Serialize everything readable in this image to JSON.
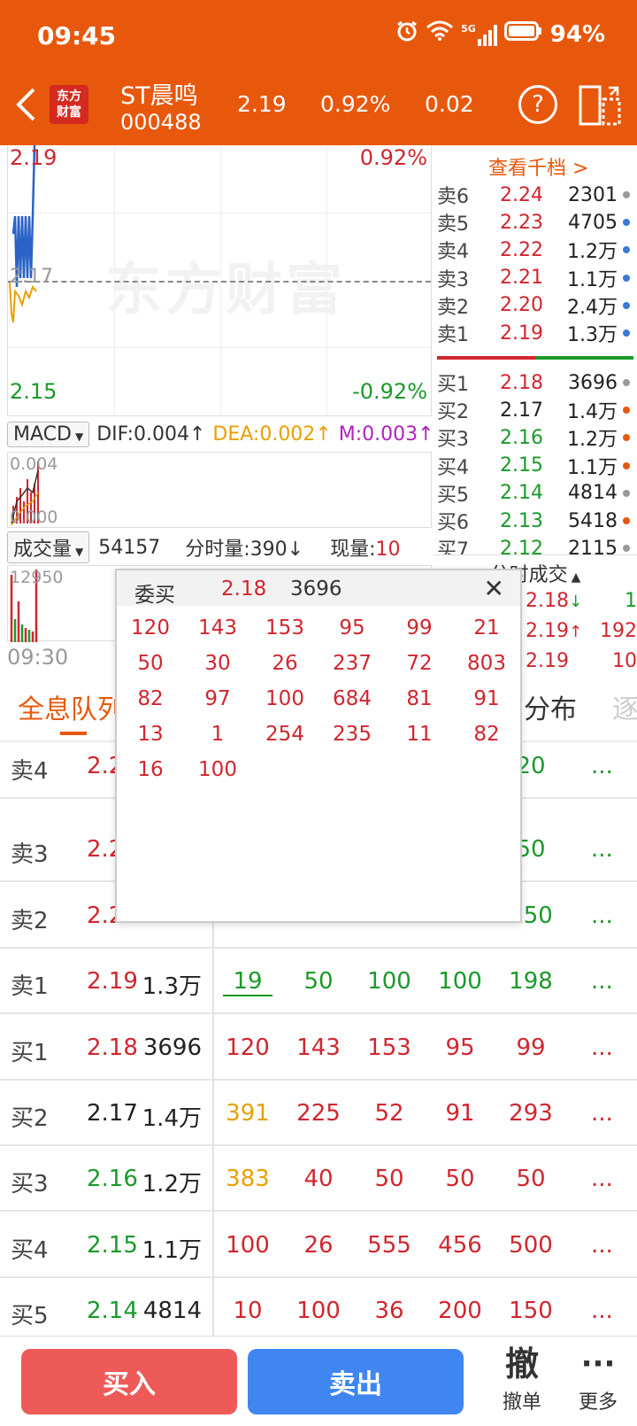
{
  "status_bar": {
    "time": "09:45",
    "battery": "94%",
    "network": "5G"
  },
  "header": {
    "logo_line1": "东方",
    "logo_line2": "财富",
    "stock_name": "ST晨鸣",
    "stock_code": "000488",
    "price": "2.19",
    "change_pct": "0.92%",
    "change": "0.02",
    "help_label": "?"
  },
  "chart": {
    "price_high": "2.19",
    "pct_high": "0.92%",
    "price_mid": "2.17",
    "price_low": "2.15",
    "pct_low": "-0.92%",
    "watermark": "东方财富",
    "time_start": "09:30",
    "price_series": [
      2.17,
      2.16,
      2.17,
      2.18,
      2.17,
      2.18,
      2.17,
      2.18,
      2.17,
      2.18,
      2.19
    ]
  },
  "macd": {
    "selector": "MACD",
    "dif": "DIF:0.004",
    "dea": "DEA:0.002",
    "m": "M:0.003",
    "top_val": "0.004",
    "bottom_val": "0.000"
  },
  "volume": {
    "selector": "成交量",
    "total": "54157",
    "tick_vol": "分时量:390",
    "now_label": "现量:",
    "now_val": "10",
    "axis_max": "12950"
  },
  "order_book": {
    "view_more": "查看千档 >",
    "asks": [
      {
        "label": "卖6",
        "price": "2.24",
        "vol": "2301",
        "color": "red",
        "dot": "#999999"
      },
      {
        "label": "卖5",
        "price": "2.23",
        "vol": "4705",
        "color": "red",
        "dot": "#3a7bd5"
      },
      {
        "label": "卖4",
        "price": "2.22",
        "vol": "1.2万",
        "color": "red",
        "dot": "#3a7bd5"
      },
      {
        "label": "卖3",
        "price": "2.21",
        "vol": "1.1万",
        "color": "red",
        "dot": "#3a7bd5"
      },
      {
        "label": "卖2",
        "price": "2.20",
        "vol": "2.4万",
        "color": "red",
        "dot": "#3a7bd5"
      },
      {
        "label": "卖1",
        "price": "2.19",
        "vol": "1.3万",
        "color": "red",
        "dot": "#3a7bd5"
      }
    ],
    "bids": [
      {
        "label": "买1",
        "price": "2.18",
        "vol": "3696",
        "color": "red",
        "dot": "#999999"
      },
      {
        "label": "买2",
        "price": "2.17",
        "vol": "1.4万",
        "color": "black",
        "dot": "#e8580c"
      },
      {
        "label": "买3",
        "price": "2.16",
        "vol": "1.2万",
        "color": "green",
        "dot": "#e8580c"
      },
      {
        "label": "买4",
        "price": "2.15",
        "vol": "1.1万",
        "color": "green",
        "dot": "#e8580c"
      },
      {
        "label": "买5",
        "price": "2.14",
        "vol": "4814",
        "color": "green",
        "dot": "#999999"
      },
      {
        "label": "买6",
        "price": "2.13",
        "vol": "5418",
        "color": "green",
        "dot": "#e8580c"
      },
      {
        "label": "买7",
        "price": "2.12",
        "vol": "2115",
        "color": "green",
        "dot": "#999999"
      }
    ],
    "ticks_title": "分时成交",
    "ticks": [
      {
        "price": "2.18",
        "dir": "↓",
        "vol": "1"
      },
      {
        "price": "2.19",
        "dir": "↑",
        "vol": "192"
      },
      {
        "price": "2.19",
        "dir": "",
        "vol": "10"
      }
    ]
  },
  "tabs": {
    "queue": "全息队列",
    "distribution": "分布",
    "more": "逐"
  },
  "queue_rows": [
    {
      "label": "卖4",
      "price": "2.2",
      "vol": "",
      "price_color": "red",
      "values": [
        "",
        "",
        "",
        "",
        "20"
      ],
      "value_colors": [
        "green",
        "green",
        "green",
        "green",
        "green"
      ],
      "more": "..."
    },
    {
      "label": "卖3",
      "price": "2.2",
      "vol": "",
      "price_color": "red",
      "values": [
        "",
        "",
        "",
        "",
        "50"
      ],
      "value_colors": [
        "green",
        "green",
        "green",
        "green",
        "green"
      ],
      "more": "..."
    },
    {
      "label": "卖2",
      "price": "2.2",
      "vol": "",
      "price_color": "red",
      "values": [
        "",
        "",
        "",
        "",
        "150"
      ],
      "value_colors": [
        "green",
        "green",
        "green",
        "green",
        "green"
      ],
      "more": "..."
    },
    {
      "label": "卖1",
      "price": "2.19",
      "vol": "1.3万",
      "price_color": "red",
      "values": [
        "19",
        "50",
        "100",
        "100",
        "198"
      ],
      "value_colors": [
        "green",
        "green",
        "green",
        "green",
        "green"
      ],
      "more": "..."
    },
    {
      "label": "买1",
      "price": "2.18",
      "vol": "3696",
      "price_color": "red",
      "values": [
        "120",
        "143",
        "153",
        "95",
        "99"
      ],
      "value_colors": [
        "red",
        "red",
        "red",
        "red",
        "red"
      ],
      "more": "..."
    },
    {
      "label": "买2",
      "price": "2.17",
      "vol": "1.4万",
      "price_color": "black",
      "values": [
        "391",
        "225",
        "52",
        "91",
        "293"
      ],
      "value_colors": [
        "orange",
        "red",
        "red",
        "red",
        "red"
      ],
      "more": "..."
    },
    {
      "label": "买3",
      "price": "2.16",
      "vol": "1.2万",
      "price_color": "green",
      "values": [
        "383",
        "40",
        "50",
        "50",
        "50"
      ],
      "value_colors": [
        "orange",
        "red",
        "red",
        "red",
        "red"
      ],
      "more": "..."
    },
    {
      "label": "买4",
      "price": "2.15",
      "vol": "1.1万",
      "price_color": "green",
      "values": [
        "100",
        "26",
        "555",
        "456",
        "500"
      ],
      "value_colors": [
        "red",
        "red",
        "red",
        "red",
        "red"
      ],
      "more": "..."
    },
    {
      "label": "买5",
      "price": "2.14",
      "vol": "4814",
      "price_color": "green",
      "values": [
        "10",
        "100",
        "36",
        "200",
        "150"
      ],
      "value_colors": [
        "red",
        "red",
        "red",
        "red",
        "red"
      ],
      "more": "..."
    }
  ],
  "popup": {
    "label": "委买",
    "price": "2.18",
    "vol": "3696",
    "close": "✕",
    "numbers": [
      "120",
      "143",
      "153",
      "95",
      "99",
      "21",
      "50",
      "30",
      "26",
      "237",
      "72",
      "803",
      "82",
      "97",
      "100",
      "684",
      "81",
      "91",
      "13",
      "1",
      "254",
      "235",
      "11",
      "82",
      "16",
      "100"
    ]
  },
  "bottom": {
    "buy": "买入",
    "sell": "卖出",
    "cancel_icon": "撤",
    "cancel": "撤单",
    "more_icon": "···",
    "more": "更多"
  }
}
